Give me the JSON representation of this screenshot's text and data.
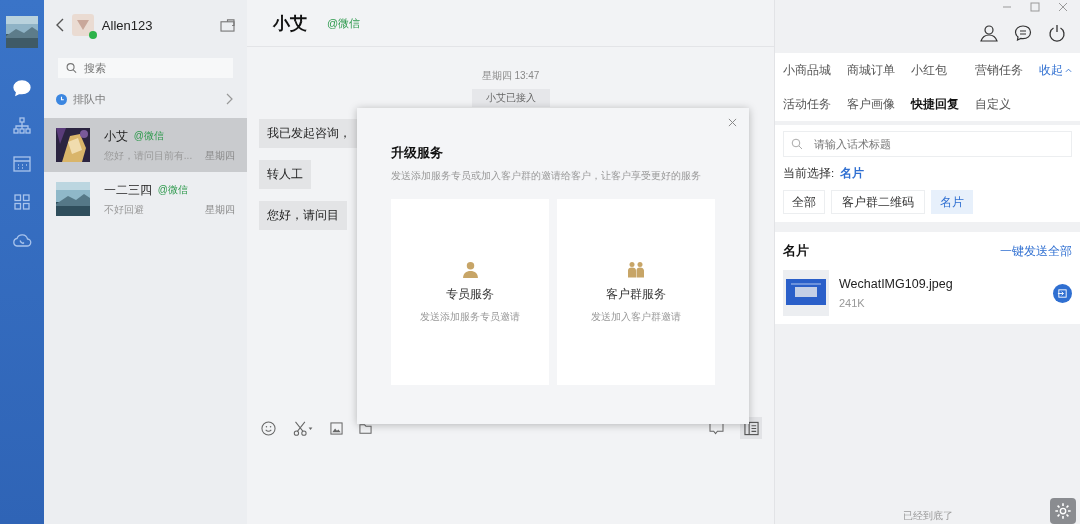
{
  "nav_rail": {
    "items": [
      {
        "kind": "chat",
        "selected": true
      },
      {
        "kind": "org",
        "selected": false
      },
      {
        "kind": "calendar",
        "selected": false
      },
      {
        "kind": "apps",
        "selected": false
      },
      {
        "kind": "cloud",
        "selected": false
      }
    ]
  },
  "account": {
    "name": "Allen123",
    "online": true
  },
  "search": {
    "placeholder": "搜索"
  },
  "queue": {
    "label": "排队中"
  },
  "conversations": [
    {
      "name": "小艾",
      "source": "@微信",
      "preview": "您好，请问目前有...",
      "time": "星期四",
      "selected": true
    },
    {
      "name": "一二三四",
      "source": "@微信",
      "preview": "不好回避",
      "time": "星期四",
      "selected": false
    }
  ],
  "chat": {
    "title": "小艾",
    "source": "@微信",
    "messages": [
      {
        "kind": "time",
        "text": "星期四 13:47"
      },
      {
        "kind": "system",
        "text": "小艾已接入"
      },
      {
        "kind": "bubble",
        "text": "我已发起咨询，"
      },
      {
        "kind": "bubble",
        "text": "转人工"
      },
      {
        "kind": "bubble",
        "text": "您好，请问目"
      }
    ]
  },
  "dialog": {
    "title": "升级服务",
    "description": "发送添加服务专员或加入客户群的邀请给客户，让客户享受更好的服务",
    "options": [
      {
        "kind": "agent",
        "title": "专员服务",
        "description": "发送添加服务专员邀请"
      },
      {
        "kind": "group",
        "title": "客户群服务",
        "description": "发送加入客户群邀请"
      }
    ]
  },
  "right_panel": {
    "tabs": [
      {
        "label": "小商品城",
        "selected": false
      },
      {
        "label": "商城订单",
        "selected": false
      },
      {
        "label": "小红包",
        "selected": false
      },
      {
        "label": "营销任务",
        "selected": false
      },
      {
        "label": "活动任务",
        "selected": false
      },
      {
        "label": "客户画像",
        "selected": false
      },
      {
        "label": "快捷回复",
        "selected": true
      },
      {
        "label": "自定义",
        "selected": false
      }
    ],
    "collapse": "收起",
    "search": {
      "placeholder": "请输入话术标题"
    },
    "current": {
      "label": "当前选择:",
      "value": "名片"
    },
    "filters": [
      {
        "label": "全部",
        "selected": false
      },
      {
        "label": "客户群二维码",
        "selected": false
      },
      {
        "label": "名片",
        "selected": true
      }
    ],
    "section": {
      "title": "名片",
      "action": "一键发送全部",
      "files": [
        {
          "name": "WechatIMG109.jpeg",
          "size": "241K"
        }
      ]
    },
    "end_text": "已经到底了"
  }
}
